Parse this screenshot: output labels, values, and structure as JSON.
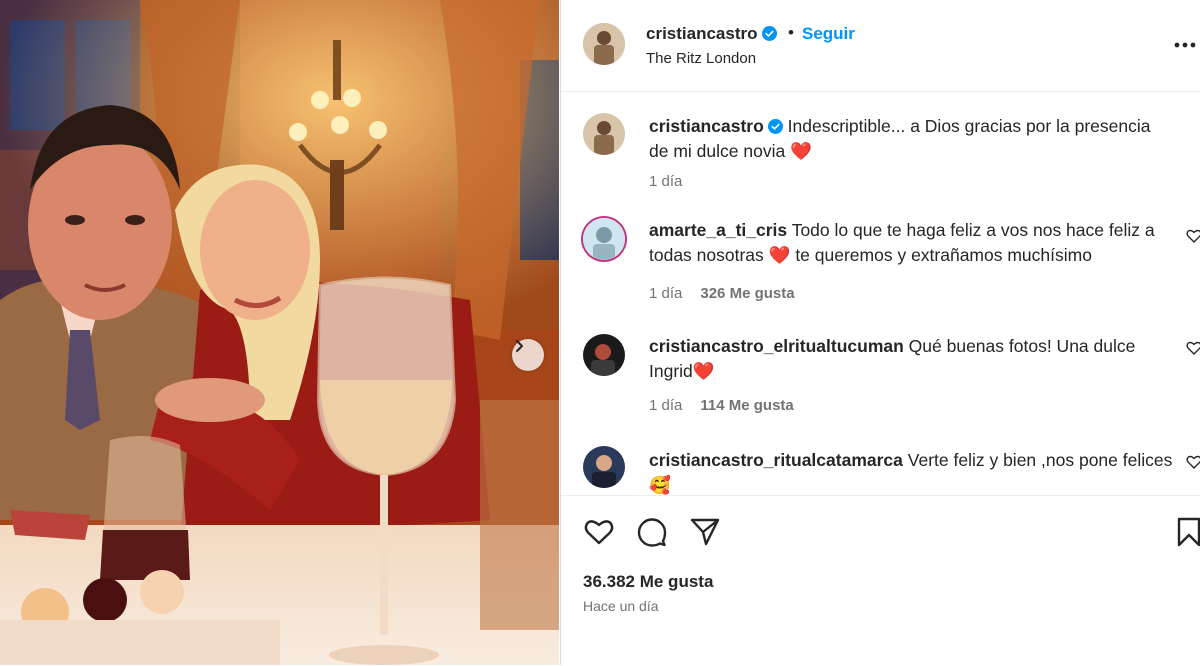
{
  "post": {
    "username": "cristiancastro",
    "follow_label": "Seguir",
    "separator": "•",
    "location": "The Ritz London",
    "likes": "36.382 Me gusta",
    "time_ago": "Hace un día",
    "image_alt": "Foto de pareja en cena en The Ritz London"
  },
  "caption": {
    "username": "cristiancastro",
    "text": " Indescriptible... a Dios gracias por la presencia de mi dulce novia ",
    "emoji": "❤️",
    "time": "1 día"
  },
  "comments": [
    {
      "username": "amarte_a_ti_cris",
      "text": " Todo lo que te haga feliz a vos nos hace feliz a todas nosotras ",
      "emoji": "❤️",
      "text_after": "  te queremos y extrañamos muchísimo",
      "time": "1 día",
      "likes": "326 Me gusta"
    },
    {
      "username": "cristiancastro_elritualtucuman",
      "text": " Qué buenas fotos! Una dulce Ingrid",
      "emoji": "❤️",
      "text_after": "",
      "time": "1 día",
      "likes": "114 Me gusta"
    },
    {
      "username": "cristiancastro_ritualcatamarca",
      "text": " Verte feliz y bien ,nos pone felices ",
      "emoji": "🥰",
      "text_after": "",
      "time": "",
      "likes": ""
    }
  ],
  "icons": {
    "verified": "verified-badge-icon",
    "more": "more-options-icon",
    "like": "heart-icon",
    "comment": "comment-icon",
    "share": "share-icon",
    "save": "bookmark-icon",
    "next": "chevron-right-icon"
  },
  "colors": {
    "accent": "#0095f6",
    "heart": "#ff3040",
    "text": "#262626",
    "muted": "#737373"
  }
}
